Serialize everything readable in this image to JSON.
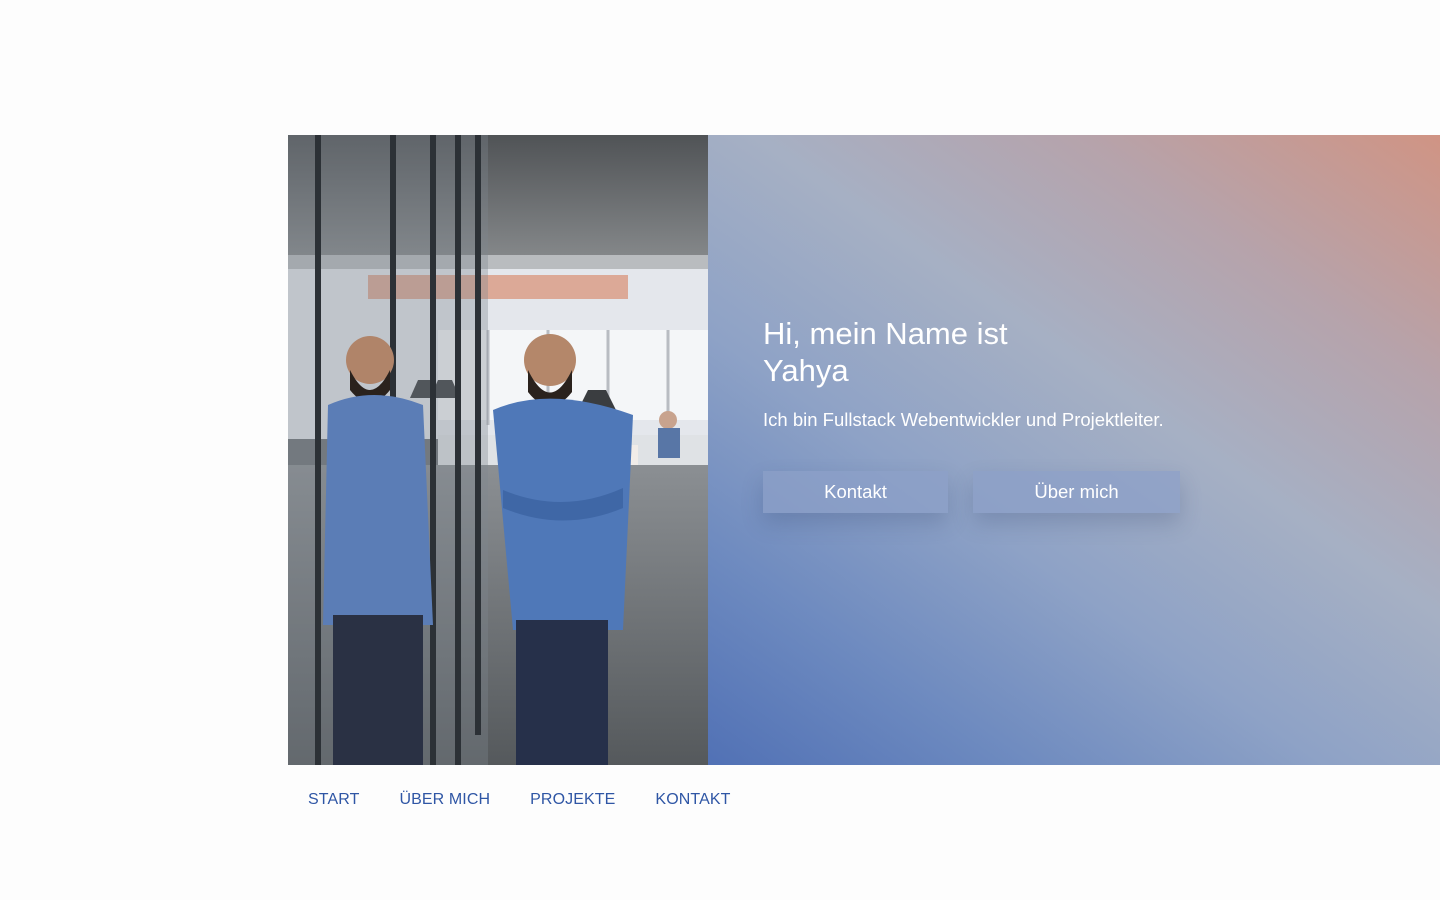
{
  "hero": {
    "headline": "Hi, mein Name ist Yahya",
    "tagline": "Ich bin Fullstack Webentwickler und Projektleiter.",
    "buttons": {
      "contact_label": "Kontakt",
      "about_label": "Über mich"
    }
  },
  "nav": {
    "items": [
      {
        "label": "START"
      },
      {
        "label": "ÜBER MICH"
      },
      {
        "label": "PROJEKTE"
      },
      {
        "label": "KONTAKT"
      }
    ]
  },
  "colors": {
    "accent": "#2f56a5",
    "gradient_start": "#5171b5",
    "gradient_end": "#d09484",
    "background": "#fdfdfd"
  }
}
